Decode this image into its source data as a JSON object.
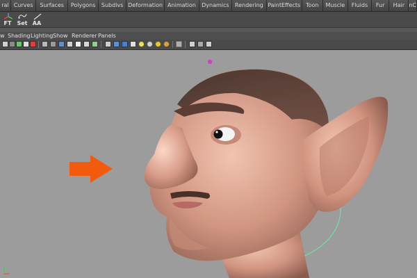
{
  "shelf_tabs": [
    "ral",
    "Curves",
    "Surfaces",
    "Polygons",
    "Subdivs",
    "Deformation",
    "Animation",
    "Dynamics",
    "Rendering",
    "PaintEffects",
    "Toon",
    "Muscle",
    "Fluids",
    "Fur",
    "Hair",
    "nC"
  ],
  "shelf_buttons": [
    {
      "label": "FT",
      "icon": "freeze-transform-icon"
    },
    {
      "label": "Set",
      "icon": "set-icon"
    },
    {
      "label": "AA",
      "icon": "anti-alias-icon"
    }
  ],
  "panel_menu": [
    "w",
    "Shading",
    "Lighting",
    "Show",
    "Renderer",
    "Panels"
  ],
  "viewport": {
    "arrow_color": "#f25a0d",
    "skin_color": "#d7a08c",
    "selection_circle_color": "#6fe0a6"
  }
}
